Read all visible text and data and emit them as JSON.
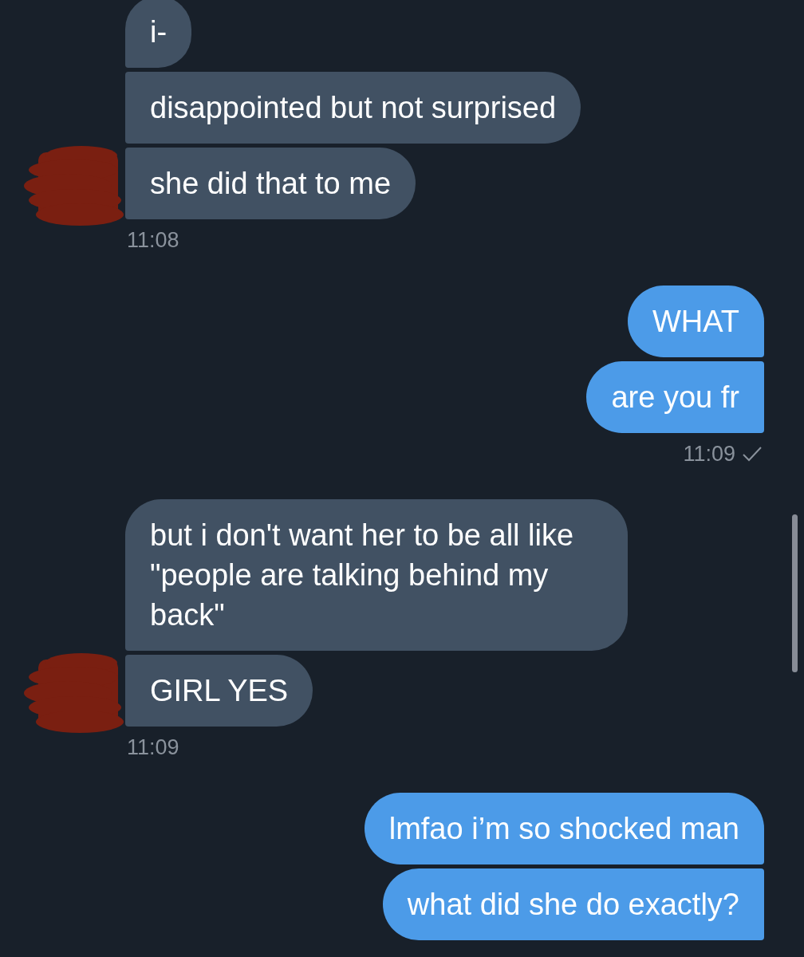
{
  "messages_view": {
    "groups": [
      {
        "kind": "incoming",
        "avatar_redacted": true,
        "messages": [
          "i-",
          "disappointed but not surprised",
          "she did that to me"
        ],
        "time": "11:08"
      },
      {
        "kind": "outgoing",
        "messages": [
          "WHAT",
          "are you fr"
        ],
        "time": "11:09",
        "read": true
      },
      {
        "kind": "incoming",
        "avatar_redacted": true,
        "messages": [
          "but i don't want her to be all like \"people are talking behind my back\"",
          "GIRL YES"
        ],
        "time": "11:09"
      },
      {
        "kind": "outgoing",
        "messages": [
          "lmfao i’m so shocked man",
          "what did she do exactly?"
        ]
      }
    ]
  }
}
